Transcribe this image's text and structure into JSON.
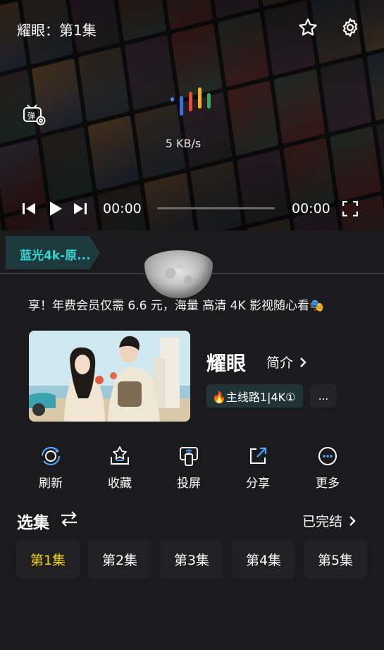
{
  "player": {
    "title": "耀眼：第1集",
    "speed": "5 KB/s",
    "current_time": "00:00",
    "total_time": "00:00",
    "icons": [
      "star-icon",
      "gear-icon",
      "danmaku-settings-icon",
      "skip-previous-icon",
      "play-icon",
      "skip-next-icon",
      "fullscreen-icon"
    ]
  },
  "source": {
    "active_label": "蓝光4k-原..."
  },
  "notice": {
    "marquee_text": "享！年费会员仅需 6.6 元，海量 高清 4K 影视随心看🎭"
  },
  "show": {
    "title": "耀眼",
    "intro_label": "简介",
    "line_label": "🔥主线路1|4K①",
    "more_label": "..."
  },
  "actions": [
    {
      "label": "刷新",
      "icon": "refresh-icon"
    },
    {
      "label": "收藏",
      "icon": "favorite-icon"
    },
    {
      "label": "投屏",
      "icon": "cast-screen-icon"
    },
    {
      "label": "分享",
      "icon": "share-icon"
    },
    {
      "label": "更多",
      "icon": "more-icon"
    }
  ],
  "episodes": {
    "header": "选集",
    "status": "已完结",
    "items": [
      "第1集",
      "第2集",
      "第3集",
      "第4集",
      "第5集"
    ],
    "active_index": 0
  },
  "colors": {
    "accent_teal": "#33d6d3",
    "active_episode": "#f5d200",
    "background": "#1b1b1d"
  }
}
